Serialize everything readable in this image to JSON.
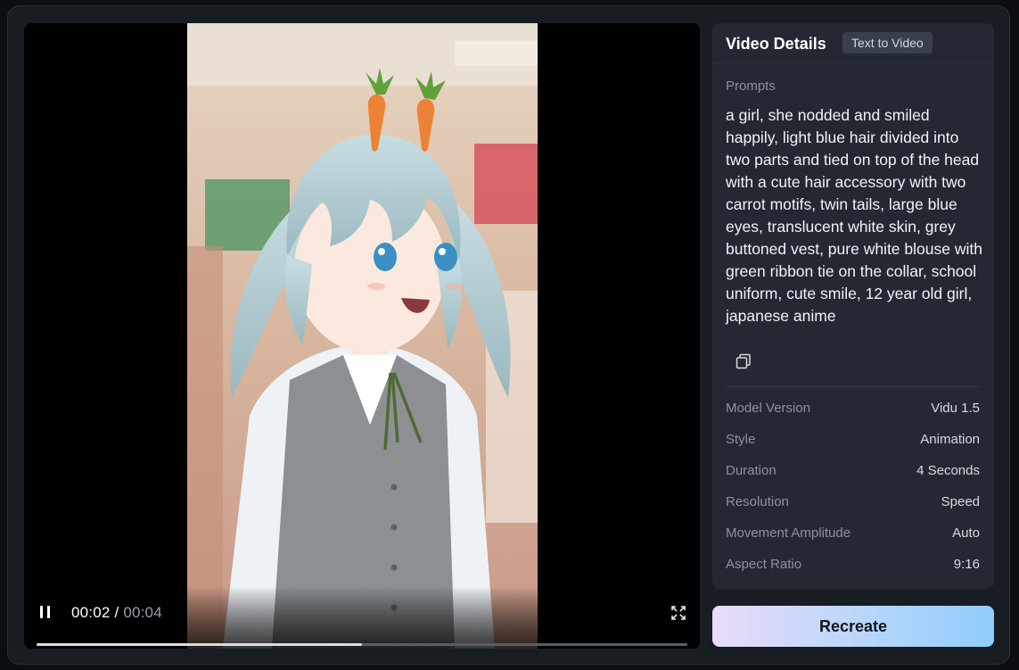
{
  "player": {
    "current_time": "00:02",
    "separator": " / ",
    "total_time": "00:04",
    "progress": 0.5,
    "frame_image": "anime-girl-light-blue-twin-tails-carrot-hair-accessory"
  },
  "details": {
    "title": "Video Details",
    "mode_tag": "Text to Video",
    "prompts_label": "Prompts",
    "prompt": "a girl, she nodded and smiled happily, light blue hair divided into two parts and tied on top of the head with a cute hair accessory with two carrot motifs, twin tails, large blue eyes, translucent white skin, grey buttoned vest, pure white blouse with green ribbon tie on the collar, school uniform, cute smile, 12 year old girl, japanese anime",
    "meta": [
      {
        "key": "Model Version",
        "value": "Vidu 1.5"
      },
      {
        "key": "Style",
        "value": "Animation"
      },
      {
        "key": "Duration",
        "value": "4 Seconds"
      },
      {
        "key": "Resolution",
        "value": "Speed"
      },
      {
        "key": "Movement Amplitude",
        "value": "Auto"
      },
      {
        "key": "Aspect Ratio",
        "value": "9:16"
      }
    ]
  },
  "actions": {
    "recreate_label": "Recreate"
  },
  "colors": {
    "panel_bg": "#232832",
    "modal_bg": "#181c23",
    "button_gradient_start": "#e8dcfb",
    "button_gradient_end": "#8fcdfb"
  }
}
